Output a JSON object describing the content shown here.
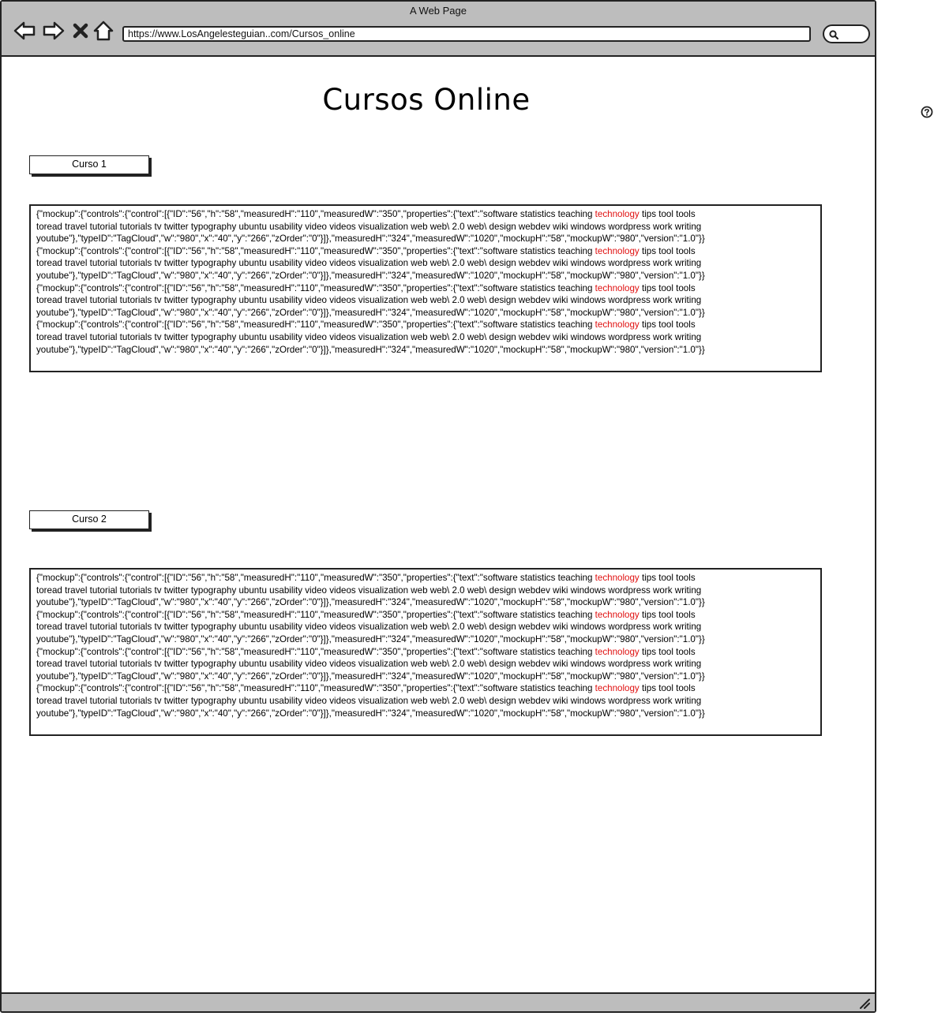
{
  "window": {
    "title": "A Web Page",
    "url": "https://www.LosAngelesteguian..com/Cursos_online"
  },
  "icons": {
    "back": "back-arrow-icon",
    "forward": "forward-arrow-icon",
    "stop": "close-icon",
    "home": "home-icon",
    "search": "search-icon",
    "help": "help-icon",
    "resize": "resize-grip-icon"
  },
  "colors": {
    "chrome": "#bdbdbd",
    "highlight": "#e01010"
  },
  "page": {
    "title": "Cursos Online"
  },
  "courses": [
    {
      "button_label": "Curso 1",
      "lines": [
        {
          "pre": "{\"mockup\":{\"controls\":{\"control\":[{\"ID\":\"56\",\"h\":\"58\",\"measuredH\":\"110\",\"measuredW\":\"350\",\"properties\":{\"text\":\"software statistics teaching ",
          "hl": "technology",
          "post": " tips tool tools"
        },
        {
          "pre": "toread travel tutorial tutorials tv twitter typography ubuntu usability video videos visualization web web\\ 2.0 web\\ design webdev wiki windows wordpress work writing",
          "hl": "",
          "post": ""
        },
        {
          "pre": "youtube\"},\"typeID\":\"TagCloud\",\"w\":\"980\",\"x\":\"40\",\"y\":\"266\",\"zOrder\":\"0\"}]},\"measuredH\":\"324\",\"measuredW\":\"1020\",\"mockupH\":\"58\",\"mockupW\":\"980\",\"version\":\"1.0\"}}",
          "hl": "",
          "post": ""
        },
        {
          "pre": "{\"mockup\":{\"controls\":{\"control\":[{\"ID\":\"56\",\"h\":\"58\",\"measuredH\":\"110\",\"measuredW\":\"350\",\"properties\":{\"text\":\"software statistics teaching ",
          "hl": "technology",
          "post": " tips tool tools"
        },
        {
          "pre": "toread travel tutorial tutorials tv twitter typography ubuntu usability video videos visualization web web\\ 2.0 web\\ design webdev wiki windows wordpress work writing",
          "hl": "",
          "post": ""
        },
        {
          "pre": "youtube\"},\"typeID\":\"TagCloud\",\"w\":\"980\",\"x\":\"40\",\"y\":\"266\",\"zOrder\":\"0\"}]},\"measuredH\":\"324\",\"measuredW\":\"1020\",\"mockupH\":\"58\",\"mockupW\":\"980\",\"version\":\"1.0\"}}",
          "hl": "",
          "post": ""
        },
        {
          "pre": "{\"mockup\":{\"controls\":{\"control\":[{\"ID\":\"56\",\"h\":\"58\",\"measuredH\":\"110\",\"measuredW\":\"350\",\"properties\":{\"text\":\"software statistics teaching ",
          "hl": "technology",
          "post": " tips tool tools"
        },
        {
          "pre": "toread travel tutorial tutorials tv twitter typography ubuntu usability video videos visualization web web\\ 2.0 web\\ design webdev wiki windows wordpress work writing",
          "hl": "",
          "post": ""
        },
        {
          "pre": "youtube\"},\"typeID\":\"TagCloud\",\"w\":\"980\",\"x\":\"40\",\"y\":\"266\",\"zOrder\":\"0\"}]},\"measuredH\":\"324\",\"measuredW\":\"1020\",\"mockupH\":\"58\",\"mockupW\":\"980\",\"version\":\"1.0\"}}",
          "hl": "",
          "post": ""
        },
        {
          "pre": "{\"mockup\":{\"controls\":{\"control\":[{\"ID\":\"56\",\"h\":\"58\",\"measuredH\":\"110\",\"measuredW\":\"350\",\"properties\":{\"text\":\"software statistics teaching ",
          "hl": "technology",
          "post": " tips tool tools"
        },
        {
          "pre": "toread travel tutorial tutorials tv twitter typography ubuntu usability video videos visualization web web\\ 2.0 web\\ design webdev wiki windows wordpress work writing",
          "hl": "",
          "post": ""
        },
        {
          "pre": "youtube\"},\"typeID\":\"TagCloud\",\"w\":\"980\",\"x\":\"40\",\"y\":\"266\",\"zOrder\":\"0\"}]},\"measuredH\":\"324\",\"measuredW\":\"1020\",\"mockupH\":\"58\",\"mockupW\":\"980\",\"version\":\"1.0\"}}",
          "hl": "",
          "post": ""
        }
      ]
    },
    {
      "button_label": "Curso 2",
      "lines": [
        {
          "pre": "{\"mockup\":{\"controls\":{\"control\":[{\"ID\":\"56\",\"h\":\"58\",\"measuredH\":\"110\",\"measuredW\":\"350\",\"properties\":{\"text\":\"software statistics teaching ",
          "hl": "technology",
          "post": " tips tool tools"
        },
        {
          "pre": "toread travel tutorial tutorials tv twitter typography ubuntu usability video videos visualization web web\\ 2.0 web\\ design webdev wiki windows wordpress work writing",
          "hl": "",
          "post": ""
        },
        {
          "pre": "youtube\"},\"typeID\":\"TagCloud\",\"w\":\"980\",\"x\":\"40\",\"y\":\"266\",\"zOrder\":\"0\"}]},\"measuredH\":\"324\",\"measuredW\":\"1020\",\"mockupH\":\"58\",\"mockupW\":\"980\",\"version\":\"1.0\"}}",
          "hl": "",
          "post": ""
        },
        {
          "pre": "{\"mockup\":{\"controls\":{\"control\":[{\"ID\":\"56\",\"h\":\"58\",\"measuredH\":\"110\",\"measuredW\":\"350\",\"properties\":{\"text\":\"software statistics teaching ",
          "hl": "technology",
          "post": " tips tool tools"
        },
        {
          "pre": "toread travel tutorial tutorials tv twitter typography ubuntu usability video videos visualization web web\\ 2.0 web\\ design webdev wiki windows wordpress work writing",
          "hl": "",
          "post": ""
        },
        {
          "pre": "youtube\"},\"typeID\":\"TagCloud\",\"w\":\"980\",\"x\":\"40\",\"y\":\"266\",\"zOrder\":\"0\"}]},\"measuredH\":\"324\",\"measuredW\":\"1020\",\"mockupH\":\"58\",\"mockupW\":\"980\",\"version\":\"1.0\"}}",
          "hl": "",
          "post": ""
        },
        {
          "pre": "{\"mockup\":{\"controls\":{\"control\":[{\"ID\":\"56\",\"h\":\"58\",\"measuredH\":\"110\",\"measuredW\":\"350\",\"properties\":{\"text\":\"software statistics teaching ",
          "hl": "technology",
          "post": " tips tool tools"
        },
        {
          "pre": "toread travel tutorial tutorials tv twitter typography ubuntu usability video videos visualization web web\\ 2.0 web\\ design webdev wiki windows wordpress work writing",
          "hl": "",
          "post": ""
        },
        {
          "pre": "youtube\"},\"typeID\":\"TagCloud\",\"w\":\"980\",\"x\":\"40\",\"y\":\"266\",\"zOrder\":\"0\"}]},\"measuredH\":\"324\",\"measuredW\":\"1020\",\"mockupH\":\"58\",\"mockupW\":\"980\",\"version\":\"1.0\"}}",
          "hl": "",
          "post": ""
        },
        {
          "pre": "{\"mockup\":{\"controls\":{\"control\":[{\"ID\":\"56\",\"h\":\"58\",\"measuredH\":\"110\",\"measuredW\":\"350\",\"properties\":{\"text\":\"software statistics teaching ",
          "hl": "technology",
          "post": " tips tool tools"
        },
        {
          "pre": "toread travel tutorial tutorials tv twitter typography ubuntu usability video videos visualization web web\\ 2.0 web\\ design webdev wiki windows wordpress work writing",
          "hl": "",
          "post": ""
        },
        {
          "pre": "youtube\"},\"typeID\":\"TagCloud\",\"w\":\"980\",\"x\":\"40\",\"y\":\"266\",\"zOrder\":\"0\"}]},\"measuredH\":\"324\",\"measuredW\":\"1020\",\"mockupH\":\"58\",\"mockupW\":\"980\",\"version\":\"1.0\"}}",
          "hl": "",
          "post": ""
        }
      ]
    }
  ]
}
